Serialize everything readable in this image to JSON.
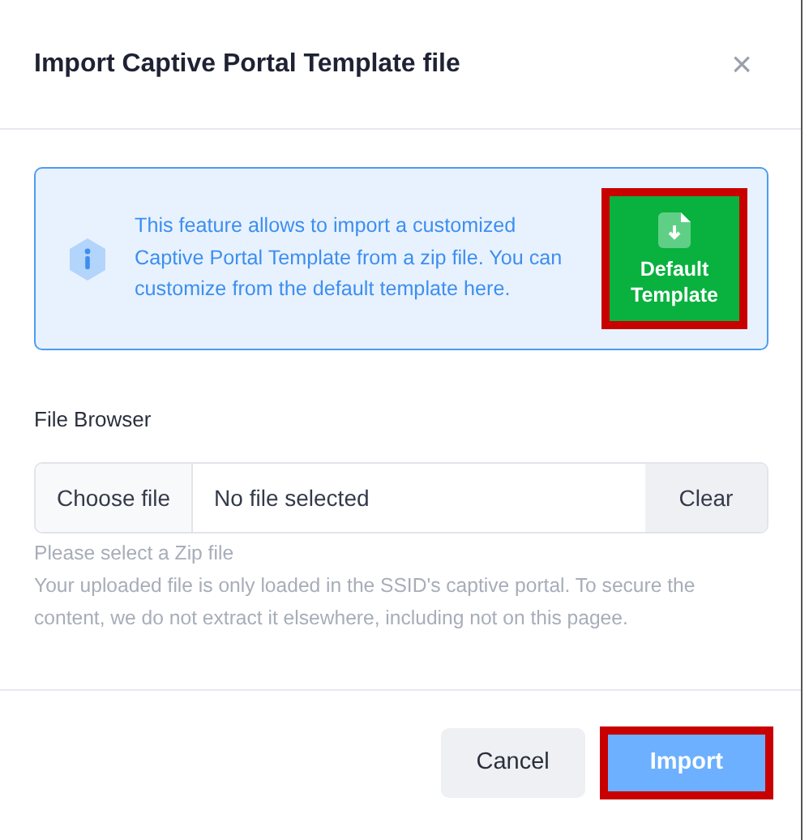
{
  "dialog": {
    "title": "Import Captive Portal Template file",
    "close": "×"
  },
  "info": {
    "text": "This feature allows to import a customized Captive Portal Template from a zip file. You can customize from the default template here.",
    "button": {
      "label_lines": [
        "Default",
        "Template"
      ],
      "highlighted": true
    }
  },
  "file_browser": {
    "label": "File Browser",
    "choose": "Choose file",
    "value": "No file selected",
    "clear": "Clear",
    "hint": "Please select a Zip file",
    "note": "Your uploaded file is only loaded in the SSID's captive portal. To secure the content, we do not extract it elsewhere, including not on this pagee."
  },
  "buttons": [
    {
      "label": "Cancel",
      "kind": "secondary",
      "highlighted": false
    },
    {
      "label": "Import",
      "kind": "primary",
      "highlighted": true
    }
  ]
}
